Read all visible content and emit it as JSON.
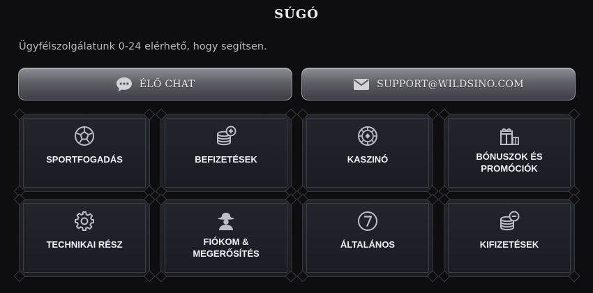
{
  "header": {
    "title": "SÚGÓ",
    "subtitle": "Ügyfélszolgálatunk 0-24 elérhető, hogy segítsen."
  },
  "contact": {
    "chat": {
      "label": "ÉLŐ CHAT",
      "icon": "chat-bubble-icon"
    },
    "email": {
      "label": "SUPPORT@WILDSINO.COM",
      "icon": "envelope-icon"
    }
  },
  "categories": [
    {
      "label": "SPORTFOGADÁS",
      "icon": "soccer-ball-icon"
    },
    {
      "label": "BEFIZETÉSEK",
      "icon": "coin-stack-plus-icon"
    },
    {
      "label": "KASZINÓ",
      "icon": "casino-chip-icon"
    },
    {
      "label": "BÓNUSZOK ÉS\nPROMÓCIÓK",
      "icon": "gift-icon"
    },
    {
      "label": "TECHNIKAI RÉSZ",
      "icon": "gear-icon"
    },
    {
      "label": "FIÓKOM &\nMEGERŐSÍTÉS",
      "icon": "cowboy-user-icon"
    },
    {
      "label": "ÁLTALÁNOS",
      "icon": "number-seven-icon"
    },
    {
      "label": "KIFIZETÉSEK",
      "icon": "coin-stack-minus-icon"
    }
  ],
  "colors": {
    "background": "#0e0e10",
    "card": "#1f2127",
    "button": "#6a6a72",
    "icon": "#bdbdc4"
  }
}
